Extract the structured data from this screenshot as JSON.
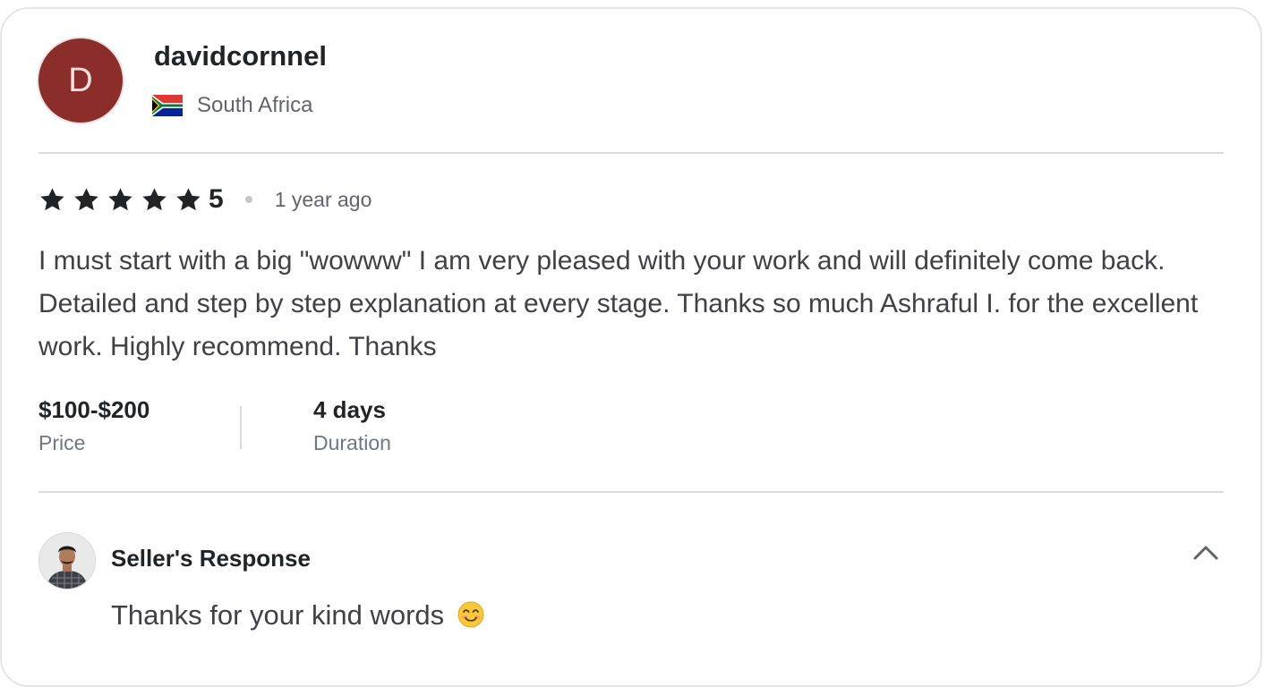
{
  "reviewer": {
    "avatar_initial": "D",
    "username": "davidcornnel",
    "country": "South Africa",
    "flag_icon": "south-africa-flag-icon"
  },
  "review": {
    "rating": "5",
    "stars": 5,
    "time_ago": "1 year ago",
    "text": "I must start with a big \"wowww\" I am very pleased with your work and will definitely come back. Detailed and step by step explanation at every stage. Thanks so much Ashraful I. for the excellent work. Highly recommend. Thanks"
  },
  "meta": {
    "price_value": "$100-$200",
    "price_label": "Price",
    "duration_value": "4 days",
    "duration_label": "Duration"
  },
  "seller_response": {
    "title": "Seller's Response",
    "text": "Thanks for your kind words",
    "emoji": "smiling-face-emoji",
    "toggle_icon": "chevron-up-icon"
  },
  "colors": {
    "avatar_bg": "#8b2d2a",
    "star": "#222325",
    "text": "#404145",
    "muted": "#62646a"
  }
}
